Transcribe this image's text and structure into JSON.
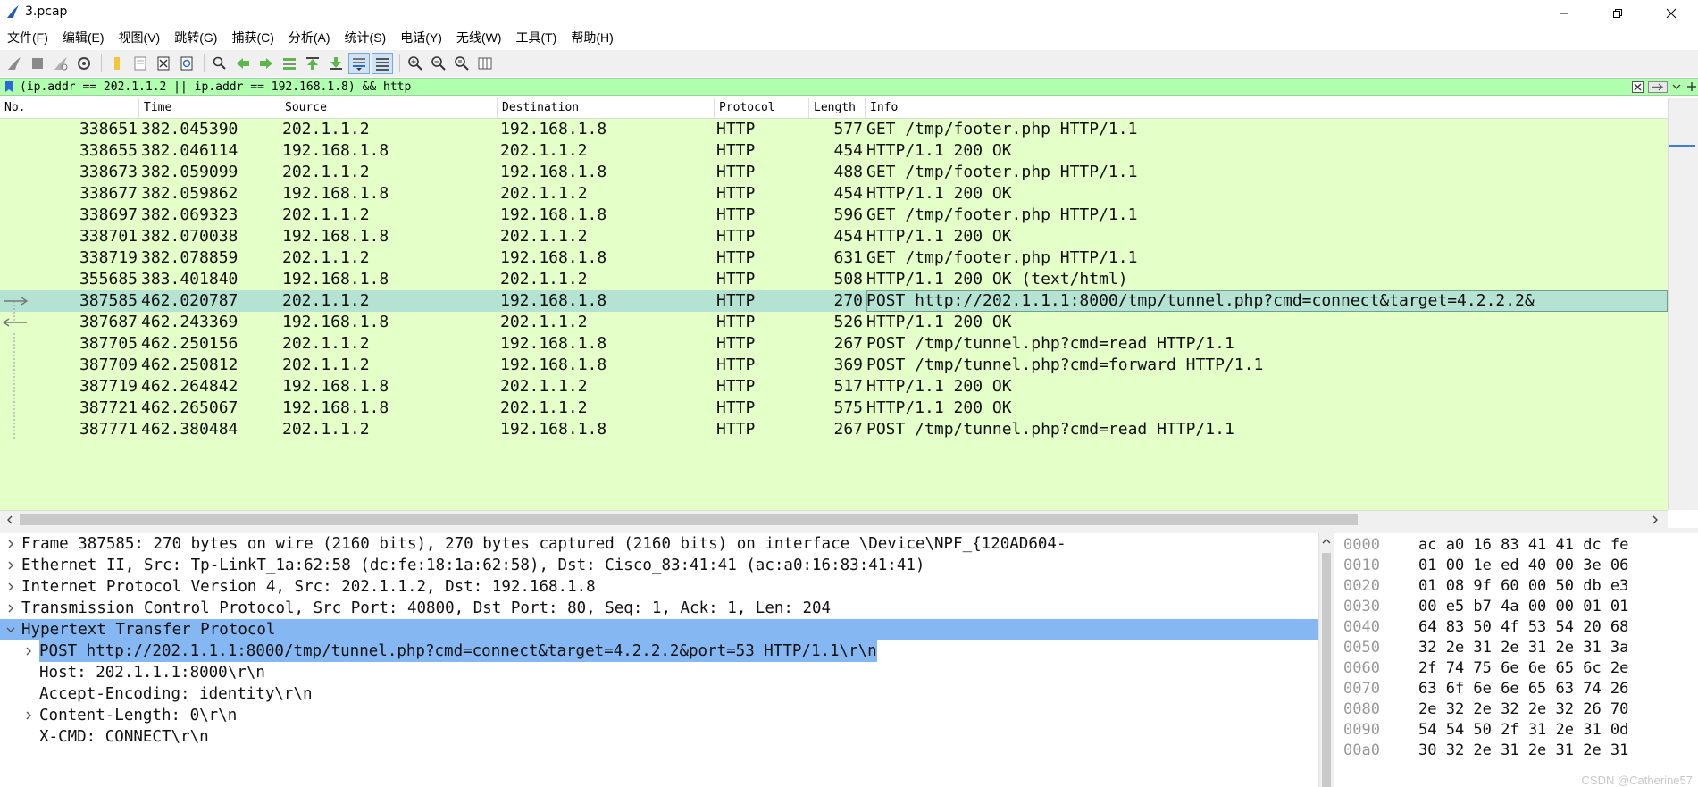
{
  "window": {
    "title": "3.pcap"
  },
  "menu": [
    "文件(F)",
    "编辑(E)",
    "视图(V)",
    "跳转(G)",
    "捕获(C)",
    "分析(A)",
    "统计(S)",
    "电话(Y)",
    "无线(W)",
    "工具(T)",
    "帮助(H)"
  ],
  "toolbar": {
    "icons": [
      "shark-fin-start-icon",
      "stop-capture-icon",
      "restart-capture-icon",
      "capture-options-icon",
      "open-file-icon",
      "save-file-icon",
      "close-file-icon",
      "reload-file-icon",
      "find-packet-icon",
      "go-back-icon",
      "go-forward-icon",
      "go-to-packet-icon",
      "go-first-icon",
      "go-last-icon",
      "auto-scroll-icon",
      "colorize-icon",
      "zoom-in-icon",
      "zoom-out-icon",
      "zoom-normal-icon",
      "resize-columns-icon"
    ]
  },
  "filter": {
    "text": "(ip.addr == 202.1.1.2 || ip.addr == 192.168.1.8) && http"
  },
  "columns": {
    "no": "No.",
    "time": "Time",
    "source": "Source",
    "destination": "Destination",
    "protocol": "Protocol",
    "length": "Length",
    "info": "Info"
  },
  "packets": [
    {
      "no": "338651",
      "time": "382.045390",
      "src": "202.1.1.2",
      "dst": "192.168.1.8",
      "proto": "HTTP",
      "len": "577",
      "info": "GET /tmp/footer.php HTTP/1.1"
    },
    {
      "no": "338655",
      "time": "382.046114",
      "src": "192.168.1.8",
      "dst": "202.1.1.2",
      "proto": "HTTP",
      "len": "454",
      "info": "HTTP/1.1 200 OK"
    },
    {
      "no": "338673",
      "time": "382.059099",
      "src": "202.1.1.2",
      "dst": "192.168.1.8",
      "proto": "HTTP",
      "len": "488",
      "info": "GET /tmp/footer.php HTTP/1.1"
    },
    {
      "no": "338677",
      "time": "382.059862",
      "src": "192.168.1.8",
      "dst": "202.1.1.2",
      "proto": "HTTP",
      "len": "454",
      "info": "HTTP/1.1 200 OK"
    },
    {
      "no": "338697",
      "time": "382.069323",
      "src": "202.1.1.2",
      "dst": "192.168.1.8",
      "proto": "HTTP",
      "len": "596",
      "info": "GET /tmp/footer.php HTTP/1.1"
    },
    {
      "no": "338701",
      "time": "382.070038",
      "src": "192.168.1.8",
      "dst": "202.1.1.2",
      "proto": "HTTP",
      "len": "454",
      "info": "HTTP/1.1 200 OK"
    },
    {
      "no": "338719",
      "time": "382.078859",
      "src": "202.1.1.2",
      "dst": "192.168.1.8",
      "proto": "HTTP",
      "len": "631",
      "info": "GET /tmp/footer.php HTTP/1.1"
    },
    {
      "no": "355685",
      "time": "383.401840",
      "src": "192.168.1.8",
      "dst": "202.1.1.2",
      "proto": "HTTP",
      "len": "508",
      "info": "HTTP/1.1 200 OK  (text/html)"
    },
    {
      "no": "387585",
      "time": "462.020787",
      "src": "202.1.1.2",
      "dst": "192.168.1.8",
      "proto": "HTTP",
      "len": "270",
      "info": "POST http://202.1.1.1:8000/tmp/tunnel.php?cmd=connect&target=4.2.2.2&"
    },
    {
      "no": "387687",
      "time": "462.243369",
      "src": "192.168.1.8",
      "dst": "202.1.1.2",
      "proto": "HTTP",
      "len": "526",
      "info": "HTTP/1.1 200 OK"
    },
    {
      "no": "387705",
      "time": "462.250156",
      "src": "202.1.1.2",
      "dst": "192.168.1.8",
      "proto": "HTTP",
      "len": "267",
      "info": "POST /tmp/tunnel.php?cmd=read HTTP/1.1"
    },
    {
      "no": "387709",
      "time": "462.250812",
      "src": "202.1.1.2",
      "dst": "192.168.1.8",
      "proto": "HTTP",
      "len": "369",
      "info": "POST /tmp/tunnel.php?cmd=forward HTTP/1.1"
    },
    {
      "no": "387719",
      "time": "462.264842",
      "src": "192.168.1.8",
      "dst": "202.1.1.2",
      "proto": "HTTP",
      "len": "517",
      "info": "HTTP/1.1 200 OK"
    },
    {
      "no": "387721",
      "time": "462.265067",
      "src": "192.168.1.8",
      "dst": "202.1.1.2",
      "proto": "HTTP",
      "len": "575",
      "info": "HTTP/1.1 200 OK"
    },
    {
      "no": "387771",
      "time": "462.380484",
      "src": "202.1.1.2",
      "dst": "192.168.1.8",
      "proto": "HTTP",
      "len": "267",
      "info": "POST /tmp/tunnel.php?cmd=read HTTP/1.1"
    }
  ],
  "selected_packet_index": 8,
  "details": [
    {
      "text": "Frame 387585: 270 bytes on wire (2160 bits), 270 bytes captured (2160 bits) on interface \\Device\\NPF_{120AD604-",
      "expander": "collapsed",
      "indent": 0
    },
    {
      "text": "Ethernet II, Src: Tp-LinkT_1a:62:58 (dc:fe:18:1a:62:58), Dst: Cisco_83:41:41 (ac:a0:16:83:41:41)",
      "expander": "collapsed",
      "indent": 0
    },
    {
      "text": "Internet Protocol Version 4, Src: 202.1.1.2, Dst: 192.168.1.8",
      "expander": "collapsed",
      "indent": 0
    },
    {
      "text": "Transmission Control Protocol, Src Port: 40800, Dst Port: 80, Seq: 1, Ack: 1, Len: 204",
      "expander": "collapsed",
      "indent": 0
    },
    {
      "text": "Hypertext Transfer Protocol",
      "expander": "expanded",
      "indent": 0,
      "highlight": "full"
    },
    {
      "text": "POST http://202.1.1.1:8000/tmp/tunnel.php?cmd=connect&target=4.2.2.2&port=53 HTTP/1.1\\r\\n",
      "expander": "collapsed",
      "indent": 1,
      "highlight": "text"
    },
    {
      "text": "Host: 202.1.1.1:8000\\r\\n",
      "expander": "none",
      "indent": 1
    },
    {
      "text": "Accept-Encoding: identity\\r\\n",
      "expander": "none",
      "indent": 1
    },
    {
      "text": "Content-Length: 0\\r\\n",
      "expander": "collapsed",
      "indent": 1
    },
    {
      "text": "X-CMD: CONNECT\\r\\n",
      "expander": "none",
      "indent": 1
    }
  ],
  "bytes": [
    {
      "offset": "0000",
      "hex": "ac a0 16 83 41 41 dc fe"
    },
    {
      "offset": "0010",
      "hex": "01 00 1e ed 40 00 3e 06"
    },
    {
      "offset": "0020",
      "hex": "01 08 9f 60 00 50 db e3"
    },
    {
      "offset": "0030",
      "hex": "00 e5 b7 4a 00 00 01 01"
    },
    {
      "offset": "0040",
      "hex": "64 83 50 4f 53 54 20 68"
    },
    {
      "offset": "0050",
      "hex": "32 2e 31 2e 31 2e 31 3a"
    },
    {
      "offset": "0060",
      "hex": "2f 74 75 6e 6e 65 6c 2e"
    },
    {
      "offset": "0070",
      "hex": "63 6f 6e 6e 65 63 74 26"
    },
    {
      "offset": "0080",
      "hex": "2e 32 2e 32 2e 32 26 70"
    },
    {
      "offset": "0090",
      "hex": "54 54 50 2f 31 2e 31 0d"
    },
    {
      "offset": "00a0",
      "hex": "30 32 2e 31 2e 31 2e 31"
    }
  ],
  "watermark": "CSDN @Catherine57",
  "colors": {
    "row_bg": "#e4ffc7",
    "row_selected": "#b5e3d3",
    "detail_highlight": "#85b8f2",
    "filter_bg": "#afffaf"
  }
}
